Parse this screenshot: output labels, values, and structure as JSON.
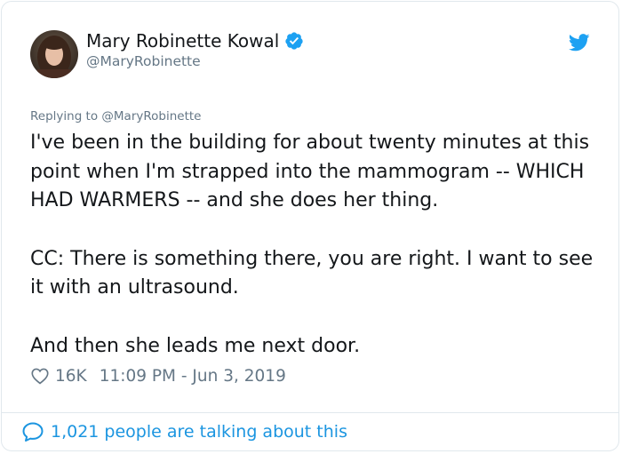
{
  "tweet": {
    "author": {
      "display_name": "Mary Robinette Kowal",
      "handle": "@MaryRobinette",
      "verified": true
    },
    "reply_context": "Replying to @MaryRobinette",
    "paragraphs": [
      "I've been in the building for about twenty minutes at this point when I'm strapped into the mammogram -- WHICH HAD WARMERS -- and she does her thing.",
      "CC: There is something there, you are right. I want to see it with an ultrasound.",
      "And then she leads me next door."
    ],
    "likes": "16K",
    "timestamp": "11:09 PM - Jun 3, 2019",
    "conversation": "1,021 people are talking about this"
  },
  "icons": {
    "verified": "verified-badge-icon",
    "brand": "twitter-bird-icon",
    "like": "heart-icon",
    "reply": "speech-bubble-icon"
  },
  "colors": {
    "accent": "#1da1f2",
    "link": "#1b95e0",
    "muted": "#657786",
    "text": "#14171a",
    "border": "#e1e8ed"
  }
}
